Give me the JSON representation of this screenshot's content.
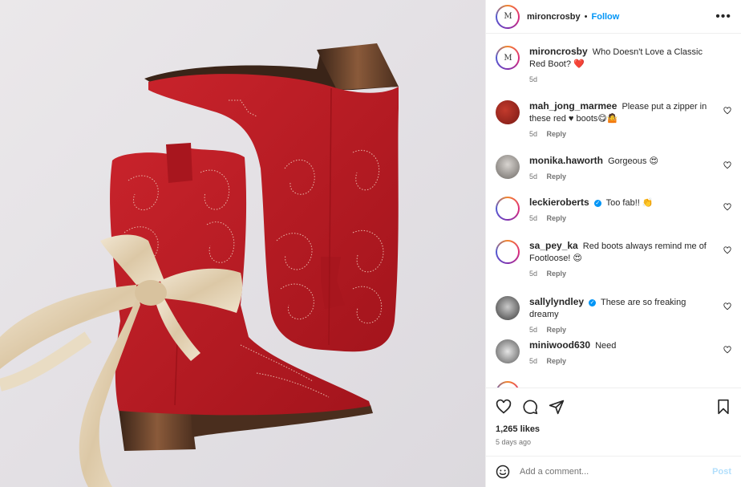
{
  "header": {
    "username": "mironcrosby",
    "separator": "•",
    "follow_label": "Follow",
    "more_label": "•••"
  },
  "caption": {
    "username": "mironcrosby",
    "text": "Who Doesn't Love a Classic Red Boot? ❤️",
    "time": "5d"
  },
  "comments": [
    {
      "username": "mah_jong_marmee",
      "verified": false,
      "text": "Please put a zipper in these red ♥ boots😋🤷",
      "time": "5d",
      "reply": "Reply"
    },
    {
      "username": "monika.haworth",
      "verified": false,
      "text": "Gorgeous 😍",
      "time": "5d",
      "reply": "Reply"
    },
    {
      "username": "leckieroberts",
      "verified": true,
      "text": "Too fab!! 👏",
      "time": "5d",
      "reply": "Reply"
    },
    {
      "username": "sa_pey_ka",
      "verified": false,
      "text": "Red boots always remind me of Footloose! 😍",
      "time": "5d",
      "reply": "Reply"
    },
    {
      "username": "sallylyndley",
      "verified": true,
      "text": "These are so freaking dreamy",
      "time": "5d",
      "reply": "Reply"
    },
    {
      "username": "miniwood630",
      "verified": false,
      "text": "Need",
      "time": "5d",
      "reply": "Reply"
    }
  ],
  "actions": {
    "likes": "1,265 likes",
    "posted_ago": "5 days ago"
  },
  "add_comment": {
    "placeholder": "Add a comment...",
    "post_label": "Post"
  },
  "icons": [
    "like-heart-icon",
    "comment-icon",
    "share-icon",
    "save-bookmark-icon",
    "emoji-icon",
    "more-options-icon",
    "verified-badge-icon"
  ],
  "colors": {
    "accent": "#0095f6",
    "post_disabled": "#b2dffc",
    "boot_red": "#b81c24",
    "ribbon": "#e6d6bd"
  }
}
